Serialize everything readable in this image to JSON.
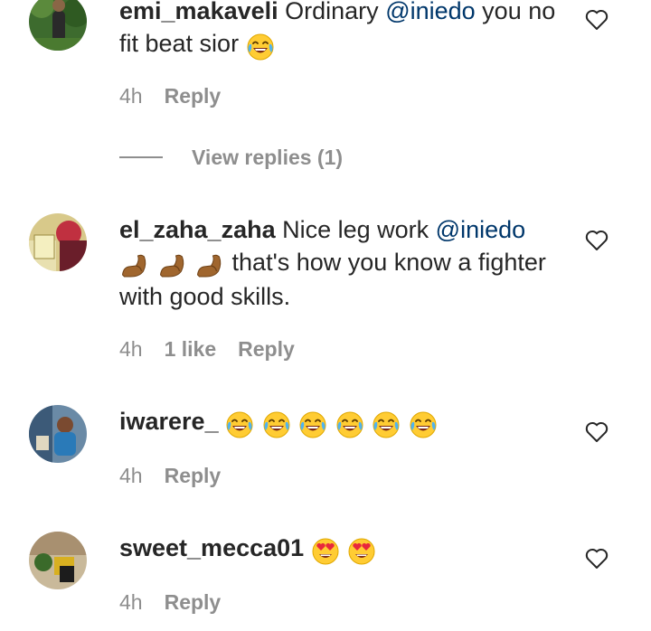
{
  "comments": [
    {
      "username": "emi_makaveli",
      "text_before": " Ordinary ",
      "mention": "@iniedo",
      "text_after": " you no fit beat sior",
      "emojis": [
        "face-with-tears-of-joy"
      ],
      "time": "4h",
      "likes": "",
      "reply_label": "Reply",
      "view_replies_label": "View replies (1)"
    },
    {
      "username": "el_zaha_zaha",
      "text_before": " Nice leg work ",
      "mention": "@iniedo",
      "emojis_inline": [
        "flexed-biceps",
        "flexed-biceps",
        "flexed-biceps"
      ],
      "text_after": " that's how you know a fighter with good skills.",
      "time": "4h",
      "likes": "1 like",
      "reply_label": "Reply"
    },
    {
      "username": "iwarere_",
      "emojis": [
        "face-with-tears-of-joy",
        "face-with-tears-of-joy",
        "face-with-tears-of-joy",
        "face-with-tears-of-joy",
        "face-with-tears-of-joy",
        "face-with-tears-of-joy"
      ],
      "time": "4h",
      "likes": "",
      "reply_label": "Reply"
    },
    {
      "username": "sweet_mecca01",
      "emojis": [
        "smiling-face-with-heart-eyes",
        "smiling-face-with-heart-eyes"
      ],
      "time": "4h",
      "likes": "",
      "reply_label": "Reply"
    }
  ],
  "colors": {
    "text": "#262626",
    "secondary": "#8e8e8e",
    "mention": "#00376b"
  },
  "icons": {
    "like": "heart-outline-icon"
  }
}
